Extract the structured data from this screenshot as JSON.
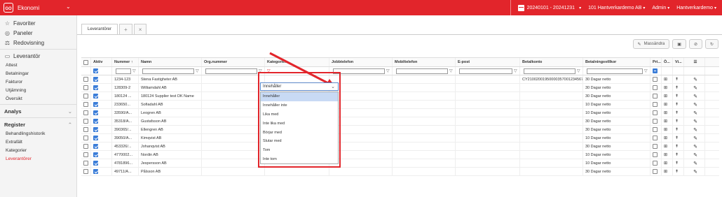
{
  "topbar": {
    "logo": "GO",
    "app_name": "Ekonomi",
    "period": "20240101 - 20241231",
    "company": "101 Hantverkardemo AB",
    "user": "Admin",
    "account": "Hantverkardemo"
  },
  "sidebar": {
    "items": [
      {
        "label": "Favoriter",
        "icon": "star-icon"
      },
      {
        "label": "Paneler",
        "icon": "compass-icon"
      },
      {
        "label": "Redovisning",
        "icon": "scale-icon"
      },
      {
        "label": "Leverantör",
        "icon": "supplier-icon"
      }
    ],
    "leverantor_sub": [
      "Attest",
      "Betalningar",
      "Fakturor",
      "Utjämning",
      "Översikt"
    ],
    "analys": "Analys",
    "register": "Register",
    "register_sub": [
      "Behandlingshistorik",
      "Extrafält",
      "Kategorier",
      "Leverantörer"
    ]
  },
  "tabs": {
    "active": "Leverantörer",
    "add": "+",
    "close": "×"
  },
  "toolbar": {
    "mass_edit": "Massändra"
  },
  "table": {
    "columns": [
      "Aktiv",
      "Nummer ↑",
      "Namn",
      "Org.nummer",
      "Kategorier",
      "Jobbtelefon",
      "Mobiltelefon",
      "E-post",
      "Betalkonto",
      "Betalningsvillkor",
      "Pri...",
      "Ö...",
      "Vi..."
    ],
    "rows": [
      {
        "nummer": "1234-123",
        "namn": "Stena Fastigheter AB",
        "betalkonto": "CY21002001950000357001234567",
        "villkor": "30 Dagar netto"
      },
      {
        "nummer": "128309-2",
        "namn": "Williamdahl AB",
        "betalkonto": "",
        "villkor": "30 Dagar netto"
      },
      {
        "nummer": "180124 ...",
        "namn": "180124 Supplier test DK Name",
        "betalkonto": "",
        "villkor": "30 Dagar netto"
      },
      {
        "nummer": "233650...",
        "namn": "Sofiadahl AB",
        "betalkonto": "",
        "villkor": "10 Dagar netto"
      },
      {
        "nummer": "33590/A...",
        "namn": "Leogren AB",
        "betalkonto": "",
        "villkor": "10 Dagar netto"
      },
      {
        "nummer": "35318/A...",
        "namn": "Gustafsson AB",
        "betalkonto": "",
        "villkor": "30 Dagar netto"
      },
      {
        "nummer": "390365/...",
        "namn": "Ellengren AB",
        "betalkonto": "",
        "villkor": "30 Dagar netto"
      },
      {
        "nummer": "39050/A...",
        "namn": "Kimqvist AB",
        "betalkonto": "",
        "villkor": "10 Dagar netto"
      },
      {
        "nummer": "453326/...",
        "namn": "Johanqvist AB",
        "betalkonto": "",
        "villkor": "30 Dagar netto"
      },
      {
        "nummer": "4770002...",
        "namn": "Nordin AB",
        "betalkonto": "",
        "villkor": "10 Dagar netto"
      },
      {
        "nummer": "4781896...",
        "namn": "Jespersson AB",
        "betalkonto": "",
        "villkor": "10 Dagar netto"
      },
      {
        "nummer": "49711/A...",
        "namn": "Pålsson AB",
        "betalkonto": "",
        "villkor": "30 Dagar netto"
      }
    ]
  },
  "filter_dropdown": {
    "selected": "Innehåller",
    "options": [
      "Innehåller",
      "Innehåller inte",
      "Lika med",
      "Inte lika med",
      "Börjar med",
      "Slutar med",
      "Tom",
      "Inte tom"
    ]
  },
  "colors": {
    "brand_red": "#e2252b",
    "checkbox_blue": "#3b7dd8",
    "option_highlight": "#c8daf4"
  }
}
